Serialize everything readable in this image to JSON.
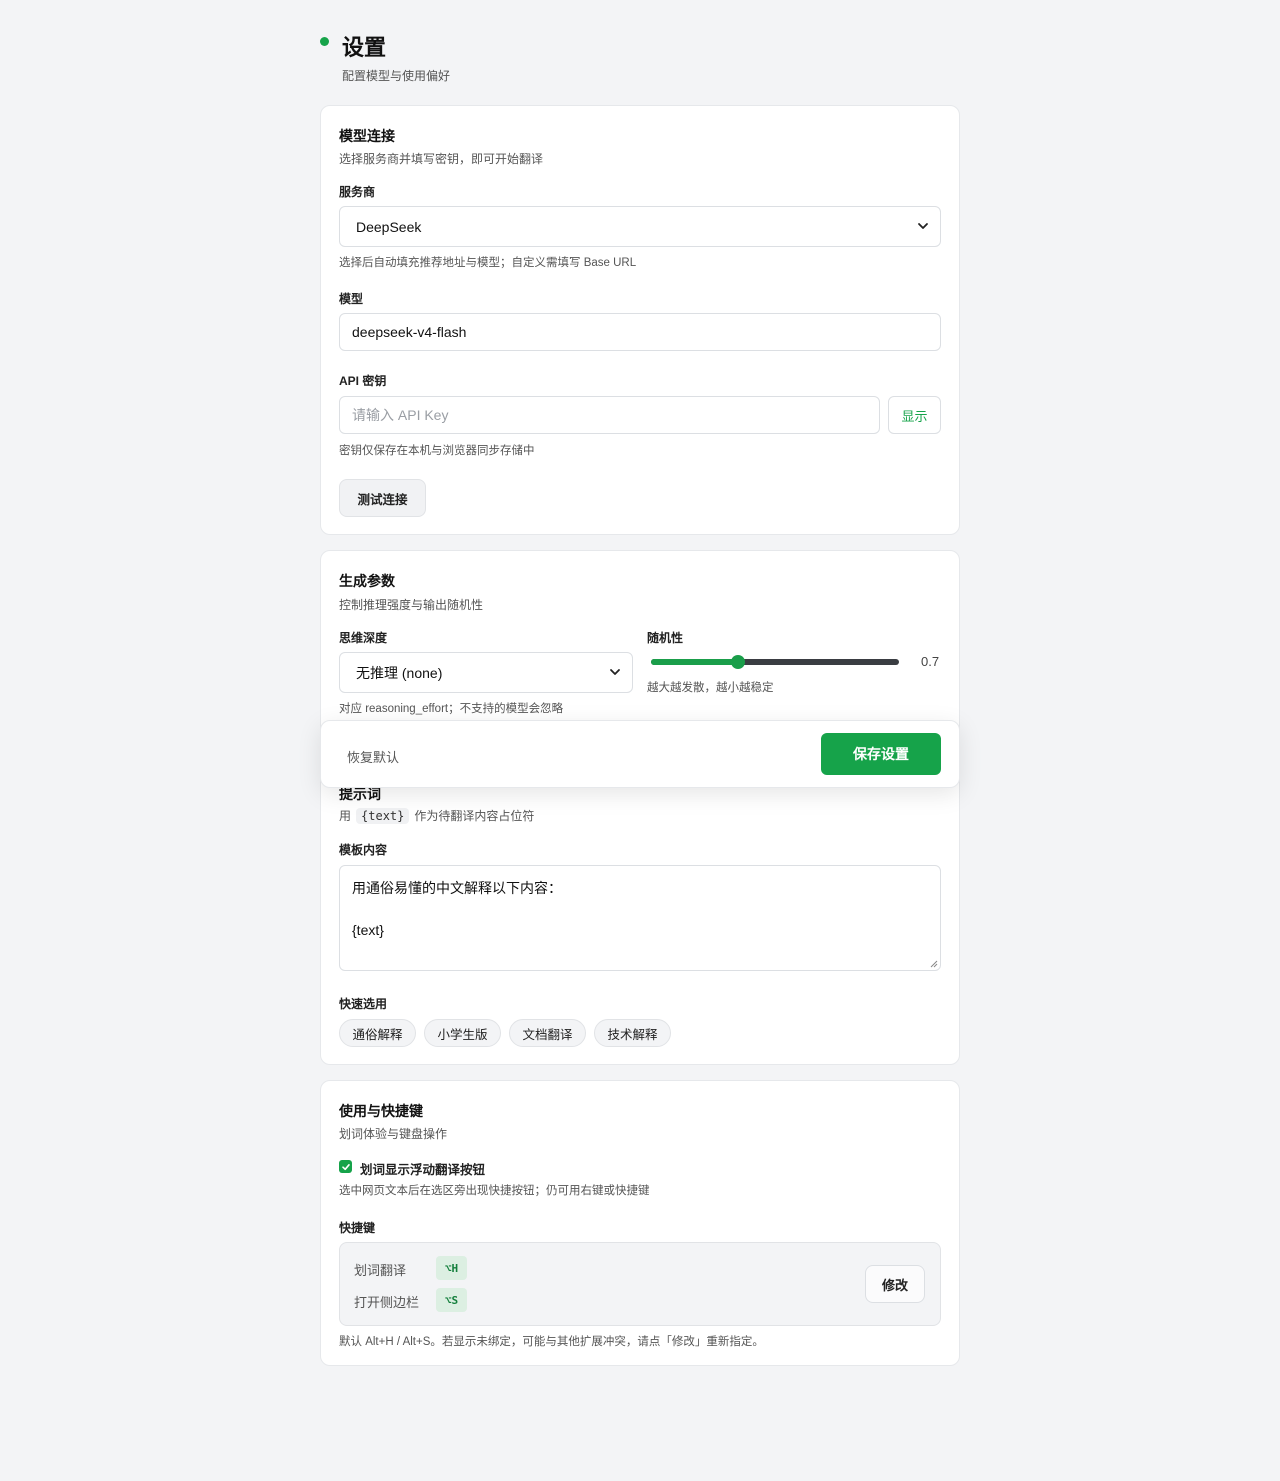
{
  "header": {
    "title": "设置",
    "subtitle": "配置模型与使用偏好",
    "accent_color": "#16a34a"
  },
  "model_connection": {
    "title": "模型连接",
    "desc": "选择服务商并填写密钥，即可开始翻译",
    "provider_label": "服务商",
    "provider_value": "DeepSeek",
    "provider_hint": "选择后自动填充推荐地址与模型；自定义需填写 Base URL",
    "model_label": "模型",
    "model_value": "deepseek-v4-flash",
    "api_key_label": "API 密钥",
    "api_key_placeholder": "请输入 API Key",
    "show_button": "显示",
    "api_key_hint": "密钥仅保存在本机与浏览器同步存储中",
    "test_button": "测试连接"
  },
  "generation": {
    "title": "生成参数",
    "desc": "控制推理强度与输出随机性",
    "depth_label": "思维深度",
    "depth_value": "无推理 (none)",
    "depth_hint": "对应 reasoning_effort；不支持的模型会忽略",
    "random_label": "随机性",
    "random_value": "0.7",
    "random_fraction": 0.35,
    "random_hint": "越大越发散，越小越稳定"
  },
  "savebar": {
    "reset_label": "恢复默认",
    "save_label": "保存设置"
  },
  "prompt": {
    "title": "提示词",
    "desc_prefix": "用",
    "desc_code": "{text}",
    "desc_suffix": "作为待翻译内容占位符",
    "template_label": "模板内容",
    "template_line1": "用通俗易懂的中文解释以下内容：",
    "template_line2": "{text}",
    "quick_label": "快速选用",
    "chips": [
      "通俗解释",
      "小学生版",
      "文档翻译",
      "技术解释"
    ]
  },
  "usage": {
    "title": "使用与快捷键",
    "desc": "划词体验与键盘操作",
    "floating_label": "划词显示浮动翻译按钮",
    "floating_checked": true,
    "floating_hint": "选中网页文本后在选区旁出现快捷按钮；仍可用右键或快捷键",
    "shortcut_label": "快捷键",
    "shortcuts": [
      {
        "name": "划词翻译",
        "key": "⌥H"
      },
      {
        "name": "打开侧边栏",
        "key": "⌥S"
      }
    ],
    "edit_button": "修改",
    "shortcut_hint": "默认 Alt+H / Alt+S。若显示未绑定，可能与其他扩展冲突，请点「修改」重新指定。"
  }
}
